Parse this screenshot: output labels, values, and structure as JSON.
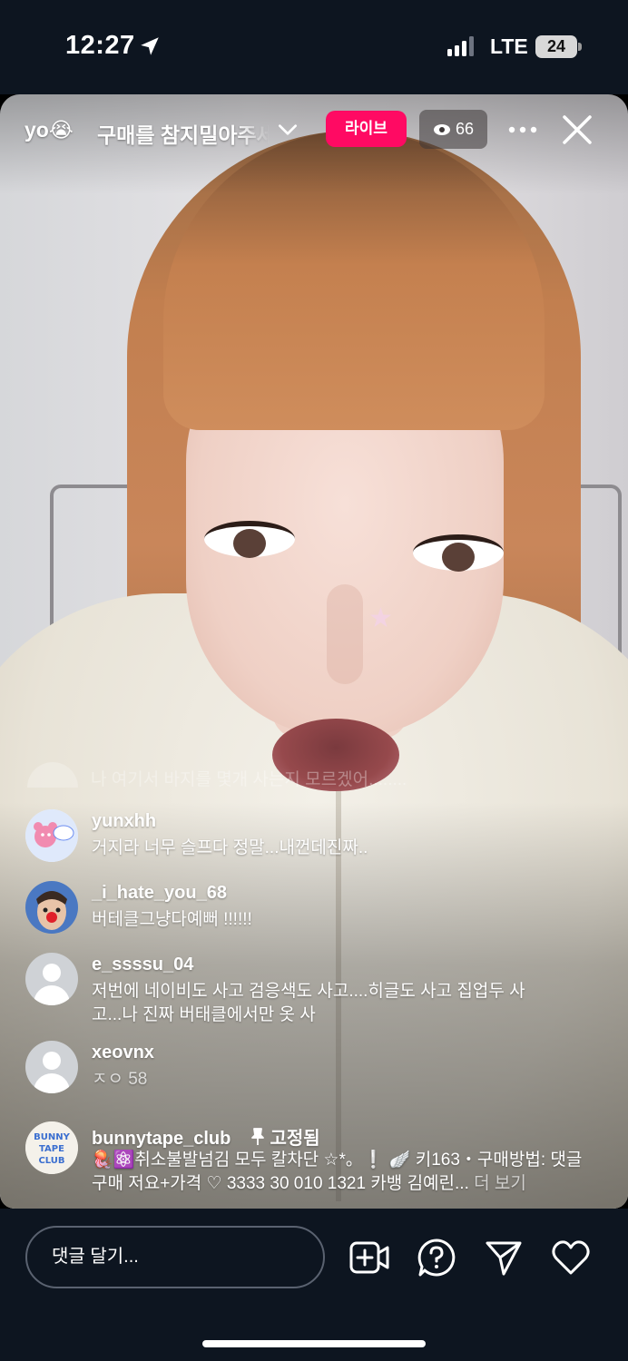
{
  "status_bar": {
    "time": "12:27",
    "network": "LTE",
    "battery": "24"
  },
  "header": {
    "host_name": "yo😭",
    "title": "구매를 참지밀아주세요",
    "live_label": "라이브",
    "viewer_count": "66"
  },
  "comments": {
    "faded_text": "나 여기서 바지를 몇개 사는지 모르겠어........",
    "items": [
      {
        "username": "yunxhh",
        "text": "거지라 너무 슬프다 정말...내껀데진짜..",
        "avatar": "bear-sticker-avatar"
      },
      {
        "username": "_i_hate_you_68",
        "text": "버테클그냥다예뻐 !!!!!!",
        "avatar": "clown-photo-avatar"
      },
      {
        "username": "e_ssssu_04",
        "text": "저번에 네이비도 사고 검응색도 사고....히글도 사고 집업두 사고...나 진짜 버태클에서만 옷 사",
        "avatar": "default-avatar"
      },
      {
        "username": "xeovnx",
        "text": "ㅈㅇ 58",
        "avatar": "default-avatar"
      }
    ],
    "pinned": {
      "username": "bunnytape_club",
      "pin_label": "고정됨",
      "text": "🪼⚛️취소불발넘김 모두 칼차단 ☆*。❕ 🪽 키163・구매방법: 댓글 구매 저요+가격 ♡ 3333 30 010 1321 카뱅 김예린...",
      "more_label": "더 보기",
      "avatar_text": "BUNNY TAPE CLUB"
    }
  },
  "bottom_bar": {
    "comment_placeholder": "댓글 달기..."
  },
  "icons": {
    "location": "location-arrow-icon",
    "signal": "cellular-signal-icon",
    "chevron": "chevron-down-icon",
    "eye": "eye-icon",
    "more": "more-horizontal-icon",
    "close": "close-icon",
    "add_guest": "add-video-icon",
    "question": "question-icon",
    "share": "paper-plane-icon",
    "like": "heart-icon"
  },
  "colors": {
    "live_badge": "#ff0a63",
    "bar_bg": "#0d1520"
  }
}
